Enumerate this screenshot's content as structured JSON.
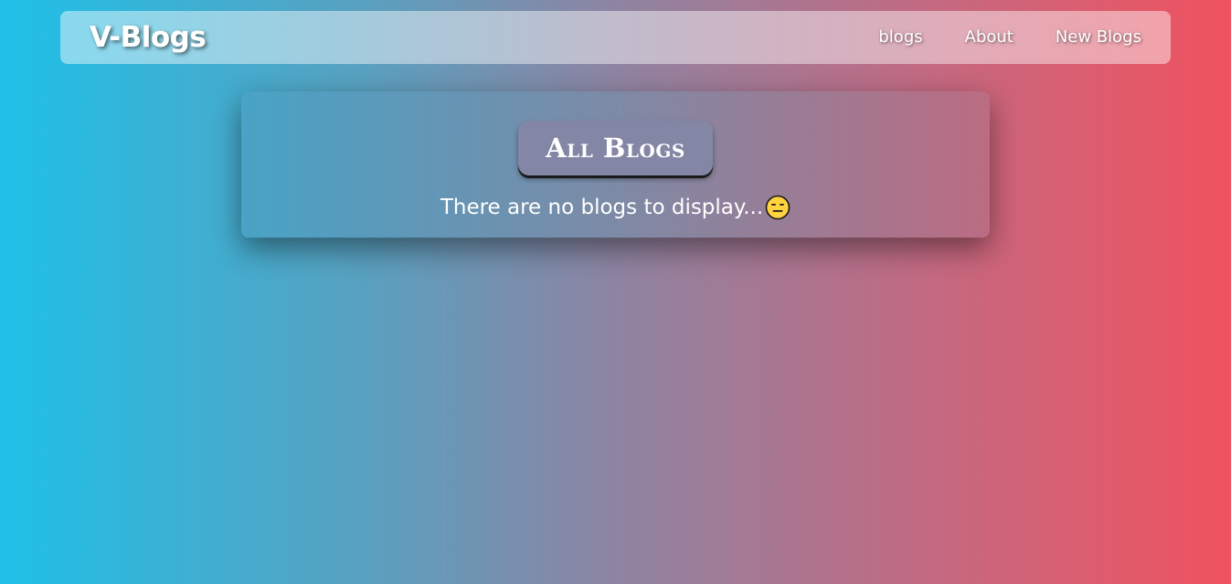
{
  "navbar": {
    "brand": "V-Blogs",
    "links": [
      "blogs",
      "About",
      "New Blogs"
    ]
  },
  "main": {
    "heading": "All Blogs",
    "empty_message": "There are no blogs to display...",
    "empty_icon": "expressionless-face-icon"
  },
  "colors": {
    "gradient_start": "#1fc0e8",
    "gradient_end": "#f0525f",
    "heading_bg": "#8386a4"
  }
}
